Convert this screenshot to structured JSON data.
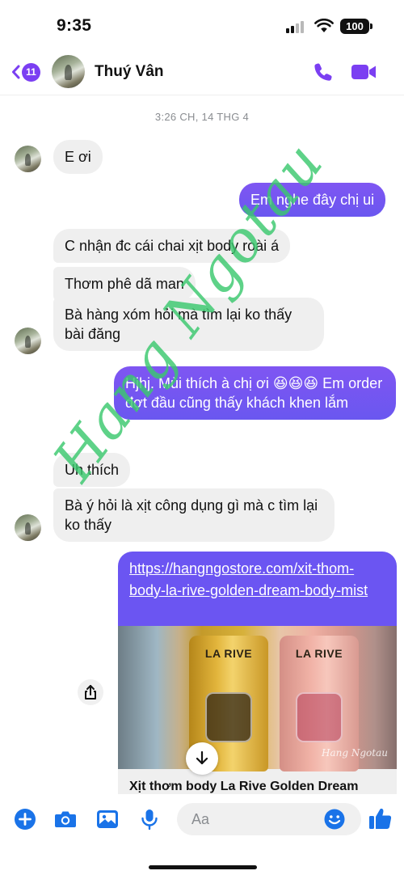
{
  "status_bar": {
    "time": "9:35",
    "battery": "100"
  },
  "header": {
    "unread_count": "11",
    "contact_name": "Thuý Vân"
  },
  "timestamp": "3:26 CH, 14 THG 4",
  "messages": [
    {
      "side": "in",
      "text": "E ơi"
    },
    {
      "side": "out",
      "text": "Em nghe đây chị ui"
    },
    {
      "side": "in",
      "text": "C nhận đc cái chai xịt body roài á"
    },
    {
      "side": "in",
      "text": "Thơm phê dã man"
    },
    {
      "side": "in",
      "text": "Bà hàng xóm hỏi mà tìm lại ko thấy bài đăng"
    },
    {
      "side": "out",
      "text": "Hjhj. Mùi thích à chị ơi 😆😆😆 Em order đợt đầu cũng thấy khách khen lắm"
    },
    {
      "side": "in",
      "text": "Uh thích"
    },
    {
      "side": "in",
      "text": "Bà ý hỏi là xịt công dụng gì mà c tìm lại ko thấy"
    }
  ],
  "link_card": {
    "url": "https://hangngostore.com/xit-thom-body-la-rive-golden-dream-body-mist",
    "image": {
      "bottle_left_label": "LA RIVE",
      "bottle_right_label": "LA RIVE",
      "watermark": "Hang Ngotau"
    },
    "title": "Xịt thơm body La Rive Golden Dream"
  },
  "watermark_text": "Hang Ngotau",
  "composer": {
    "placeholder": "Aa"
  },
  "colors": {
    "accent": "#7b3ff2",
    "outgoing_bubble": "#6f56f2",
    "incoming_bubble": "#efefef",
    "watermark": "#3ac86e",
    "composer_icons": "#1a73e8"
  },
  "icons": [
    "back-chevron-icon",
    "phone-icon",
    "video-camera-icon",
    "share-icon",
    "download-icon",
    "plus-icon",
    "camera-icon",
    "image-icon",
    "microphone-icon",
    "emoji-icon",
    "thumbs-up-icon"
  ]
}
